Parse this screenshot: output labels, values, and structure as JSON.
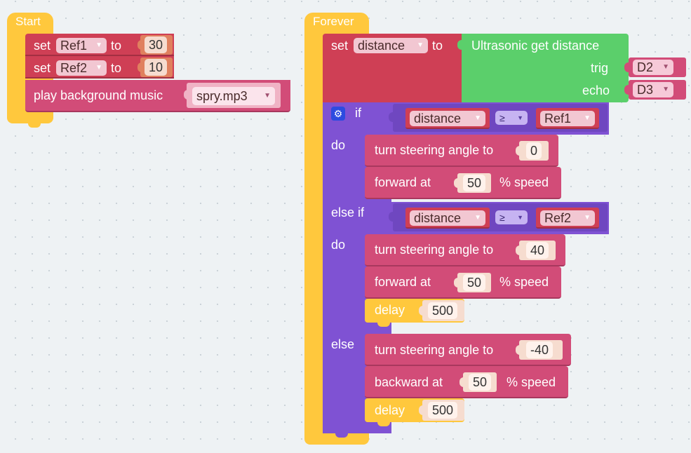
{
  "start": {
    "title": "Start",
    "set_label": "set",
    "to_label": "to",
    "rows": [
      {
        "var": "Ref1",
        "value": "30"
      },
      {
        "var": "Ref2",
        "value": "10"
      }
    ],
    "music_label": "play background music",
    "music_file": "spry.mp3"
  },
  "forever": {
    "title": "Forever",
    "set_label": "set",
    "var": "distance",
    "to_label": "to",
    "ultra_label": "Ultrasonic get distance",
    "trig_label": "trig",
    "trig_value": "D2",
    "echo_label": "echo",
    "echo_value": "D3",
    "if_label": "if",
    "do_label": "do",
    "elseif_label": "else if",
    "else_label": "else",
    "cond1": {
      "left": "distance",
      "op": "≥",
      "right": "Ref1"
    },
    "cond2": {
      "left": "distance",
      "op": "≥",
      "right": "Ref2"
    },
    "steer_label": "turn steering angle to",
    "forward_label": "forward at",
    "backward_label": "backward at",
    "speed_unit": "% speed",
    "delay_label": "delay",
    "branch1": {
      "angle": "0",
      "speed": "50"
    },
    "branch2": {
      "angle": "40",
      "speed": "50",
      "delay": "500"
    },
    "branch3": {
      "angle": "-40",
      "speed": "50",
      "delay": "500"
    }
  },
  "colors": {
    "event": "#ffc83d",
    "variable": "#cf3f55",
    "action": "#d24c78",
    "sensor": "#5bcf6b",
    "logic": "#7f52d3"
  }
}
